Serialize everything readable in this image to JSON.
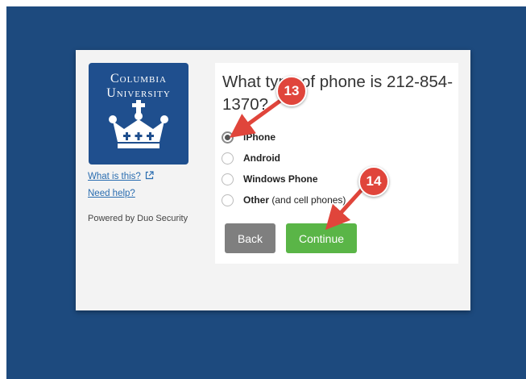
{
  "university": {
    "logo_line1": "Columbia",
    "logo_line2": "University"
  },
  "sidebar": {
    "what_is_this": "What is this?",
    "need_help": "Need help?",
    "powered_by": "Powered by Duo Security"
  },
  "question": "What type of phone is 212-854-1370?",
  "options": [
    {
      "bold": "iPhone",
      "rest": "",
      "checked": true
    },
    {
      "bold": "Android",
      "rest": "",
      "checked": false
    },
    {
      "bold": "Windows Phone",
      "rest": "",
      "checked": false
    },
    {
      "bold": "Other",
      "rest": " (and cell phones)",
      "checked": false
    }
  ],
  "buttons": {
    "back": "Back",
    "continue": "Continue"
  },
  "annotations": {
    "step1": "13",
    "step2": "14"
  },
  "colors": {
    "backdrop": "#1d4a7e",
    "logo_bg": "#1f4f8e",
    "continue": "#5ab547",
    "back": "#7f7f7f",
    "annotation": "#e0453b"
  },
  "icons": {
    "external_link": "external-link-icon",
    "crown": "crown-icon"
  }
}
